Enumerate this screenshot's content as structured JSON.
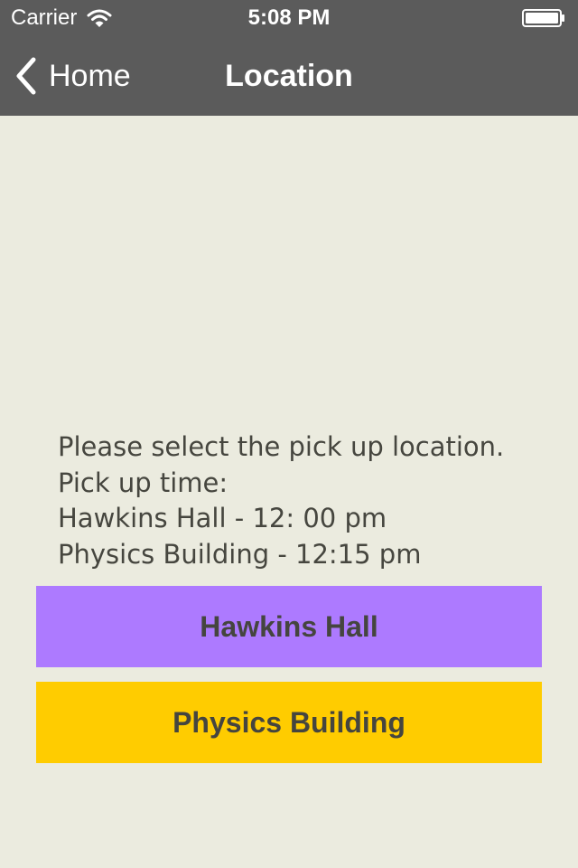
{
  "status_bar": {
    "carrier": "Carrier",
    "time": "5:08 PM"
  },
  "nav": {
    "back_label": "Home",
    "title": "Location"
  },
  "instructions": {
    "line1": "Please select the pick up location.",
    "line2": "Pick up time:",
    "line3": "Hawkins Hall - 12: 00 pm",
    "line4": "Physics Building - 12:15 pm"
  },
  "buttons": {
    "hawkins": "Hawkins Hall",
    "physics": "Physics Building"
  },
  "colors": {
    "nav_background": "#5b5b5b",
    "page_background": "#ebebdf",
    "hawkins_button": "#ad7aff",
    "physics_button": "#ffcc00",
    "text": "#46463f"
  },
  "icons": {
    "wifi": "wifi-icon",
    "battery": "battery-icon",
    "back": "chevron-left-icon"
  }
}
